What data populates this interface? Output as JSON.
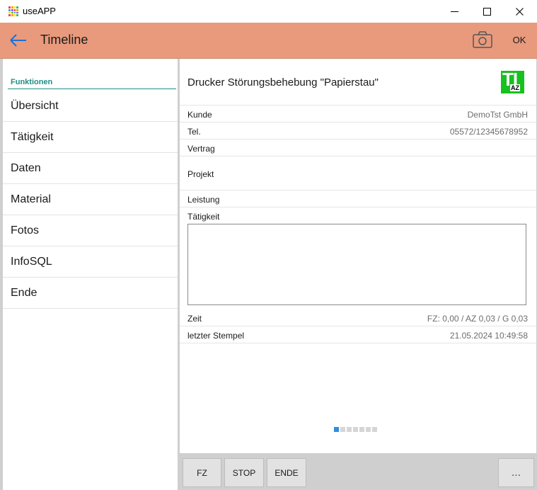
{
  "window": {
    "title": "useAPP",
    "controls": [
      "minimize-icon",
      "maximize-icon",
      "close-icon"
    ]
  },
  "appbar": {
    "title": "Timeline",
    "ok_label": "OK",
    "icons": [
      "back-arrow-icon",
      "camera-icon"
    ],
    "background": "#e99a7c"
  },
  "sidebar": {
    "heading": "Funktionen",
    "accent": "#1f8e86",
    "items": [
      {
        "label": "Übersicht"
      },
      {
        "label": "Tätigkeit"
      },
      {
        "label": "Daten"
      },
      {
        "label": "Material"
      },
      {
        "label": "Fotos"
      },
      {
        "label": "InfoSQL"
      },
      {
        "label": "Ende"
      }
    ]
  },
  "main": {
    "title": "Drucker Störungsbehebung \"Papierstau\"",
    "logo": {
      "main": "TI",
      "sub": "AZ"
    },
    "fields": {
      "kunde": {
        "label": "Kunde",
        "value": "DemoTst GmbH"
      },
      "tel": {
        "label": "Tel.",
        "value": "05572/12345678952"
      },
      "vertrag": {
        "label": "Vertrag",
        "value": ""
      },
      "projekt": {
        "label": "Projekt",
        "value": ""
      },
      "leistung": {
        "label": "Leistung",
        "value": ""
      },
      "taetigkeit": {
        "label": "Tätigkeit",
        "value": ""
      },
      "zeit": {
        "label": "Zeit",
        "value": "FZ: 0,00 / AZ 0,03 / G 0,03"
      },
      "stempel": {
        "label": "letzter Stempel",
        "value": "21.05.2024 10:49:58"
      }
    },
    "pager": {
      "pages": 7,
      "active_index": 0,
      "active_color": "#2f8fe0"
    }
  },
  "footer": {
    "fz_label": "FZ",
    "stop_label": "STOP",
    "ende_label": "ENDE",
    "more_label": "..."
  }
}
